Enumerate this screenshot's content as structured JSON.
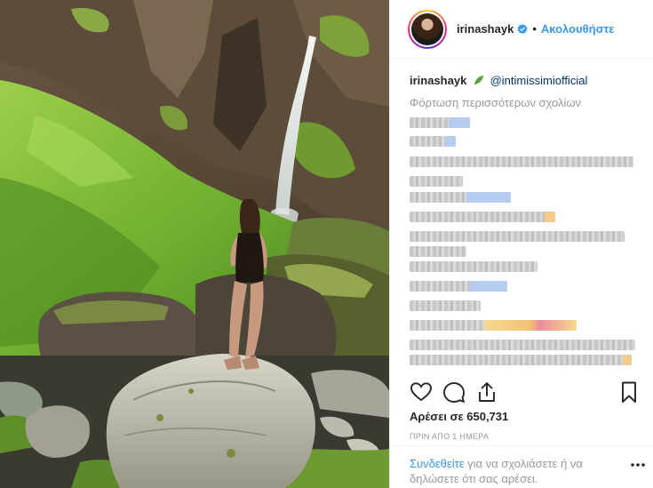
{
  "post": {
    "username": "irinashayk",
    "follow_label": "Ακολουθήστε",
    "separator": "•",
    "caption_user": "irinashayk",
    "caption_mention": "@intimissimiofficial",
    "load_more": "Φόρτωση περισσότερων σχολίων",
    "likes": "Αρέσει σε 650,731",
    "time_ago": "ΠΡΙΝ ΑΠΟ 1 ΗΜΕΡΑ",
    "login_link": "Συνδεθείτε",
    "login_rest": " για να σχολιάσετε ή να δηλώσετε ότι σας αρέσει."
  },
  "icons": {
    "verified": "verified-badge-icon",
    "caption_emoji": "leaf-icon",
    "like": "heart-icon",
    "comment": "comment-icon",
    "share": "share-icon",
    "save": "bookmark-icon",
    "more": "more-options-icon"
  },
  "colors": {
    "link": "#3897f0",
    "mention": "#003569",
    "muted": "#999999",
    "text": "#262626",
    "verified": "#3897f0"
  }
}
